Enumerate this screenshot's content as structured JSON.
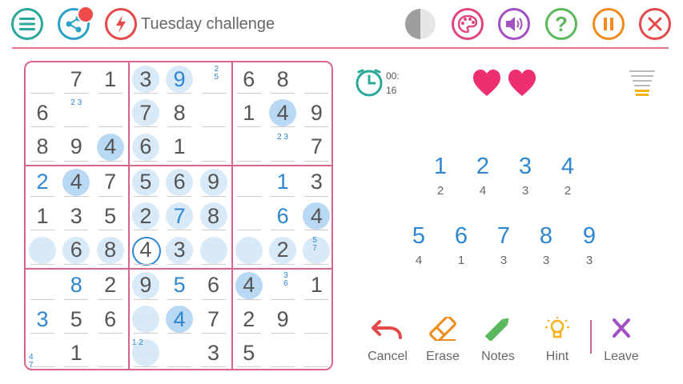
{
  "title": "Tuesday challenge",
  "top_icons": {
    "menu_color": "#2aa89a",
    "share_color": "#2aa2c7",
    "challenge_color": "#e54848",
    "contrast_color": "#9e9e9e",
    "palette_color": "#e0457b",
    "sound_color": "#a34fc4",
    "help_color": "#5cb85c",
    "pause_color": "#f08a1c",
    "close_color": "#e54848"
  },
  "timer": {
    "line1": "00:",
    "line2": "16"
  },
  "lives": 2,
  "board": {
    "rows": [
      [
        "",
        "7",
        "1",
        "3",
        "9",
        "",
        "6",
        "8",
        ""
      ],
      [
        "6",
        "",
        "",
        "7",
        "8",
        "",
        "1",
        "4",
        "9"
      ],
      [
        "8",
        "9",
        "4",
        "6",
        "1",
        "",
        "",
        "",
        "7"
      ],
      [
        "2",
        "4",
        "7",
        "5",
        "6",
        "9",
        "",
        "1",
        "3"
      ],
      [
        "1",
        "3",
        "5",
        "2",
        "7",
        "8",
        "",
        "6",
        "4"
      ],
      [
        "",
        "6",
        "8",
        "4",
        "3",
        "",
        "",
        "2",
        ""
      ],
      [
        "",
        "8",
        "2",
        "9",
        "5",
        "6",
        "4",
        "",
        "1"
      ],
      [
        "3",
        "5",
        "6",
        "",
        "4",
        "7",
        "2",
        "9",
        ""
      ],
      [
        "",
        "1",
        "",
        "",
        "",
        "3",
        "5",
        "",
        ""
      ]
    ],
    "notes": [
      {
        "r": 0,
        "c": 5,
        "text": "2\n5"
      },
      {
        "r": 1,
        "c": 1,
        "text": "2 3"
      },
      {
        "r": 2,
        "c": 7,
        "text": "2 3"
      },
      {
        "r": 5,
        "c": 8,
        "text": "5\n7"
      },
      {
        "r": 6,
        "c": 7,
        "text": "3\n6"
      },
      {
        "r": 8,
        "c": 0,
        "text": "4\n7"
      },
      {
        "r": 8,
        "c": 3,
        "text": "1 2"
      }
    ]
  },
  "number_pad": [
    {
      "digit": "1",
      "remaining": "2"
    },
    {
      "digit": "2",
      "remaining": "4"
    },
    {
      "digit": "3",
      "remaining": "3"
    },
    {
      "digit": "4",
      "remaining": "2"
    },
    {
      "digit": "5",
      "remaining": "4"
    },
    {
      "digit": "6",
      "remaining": "1"
    },
    {
      "digit": "7",
      "remaining": "3"
    },
    {
      "digit": "8",
      "remaining": "3"
    },
    {
      "digit": "9",
      "remaining": "3"
    }
  ],
  "actions": {
    "cancel": "Cancel",
    "erase": "Erase",
    "notes": "Notes",
    "hint": "Hint",
    "leave": "Leave"
  }
}
